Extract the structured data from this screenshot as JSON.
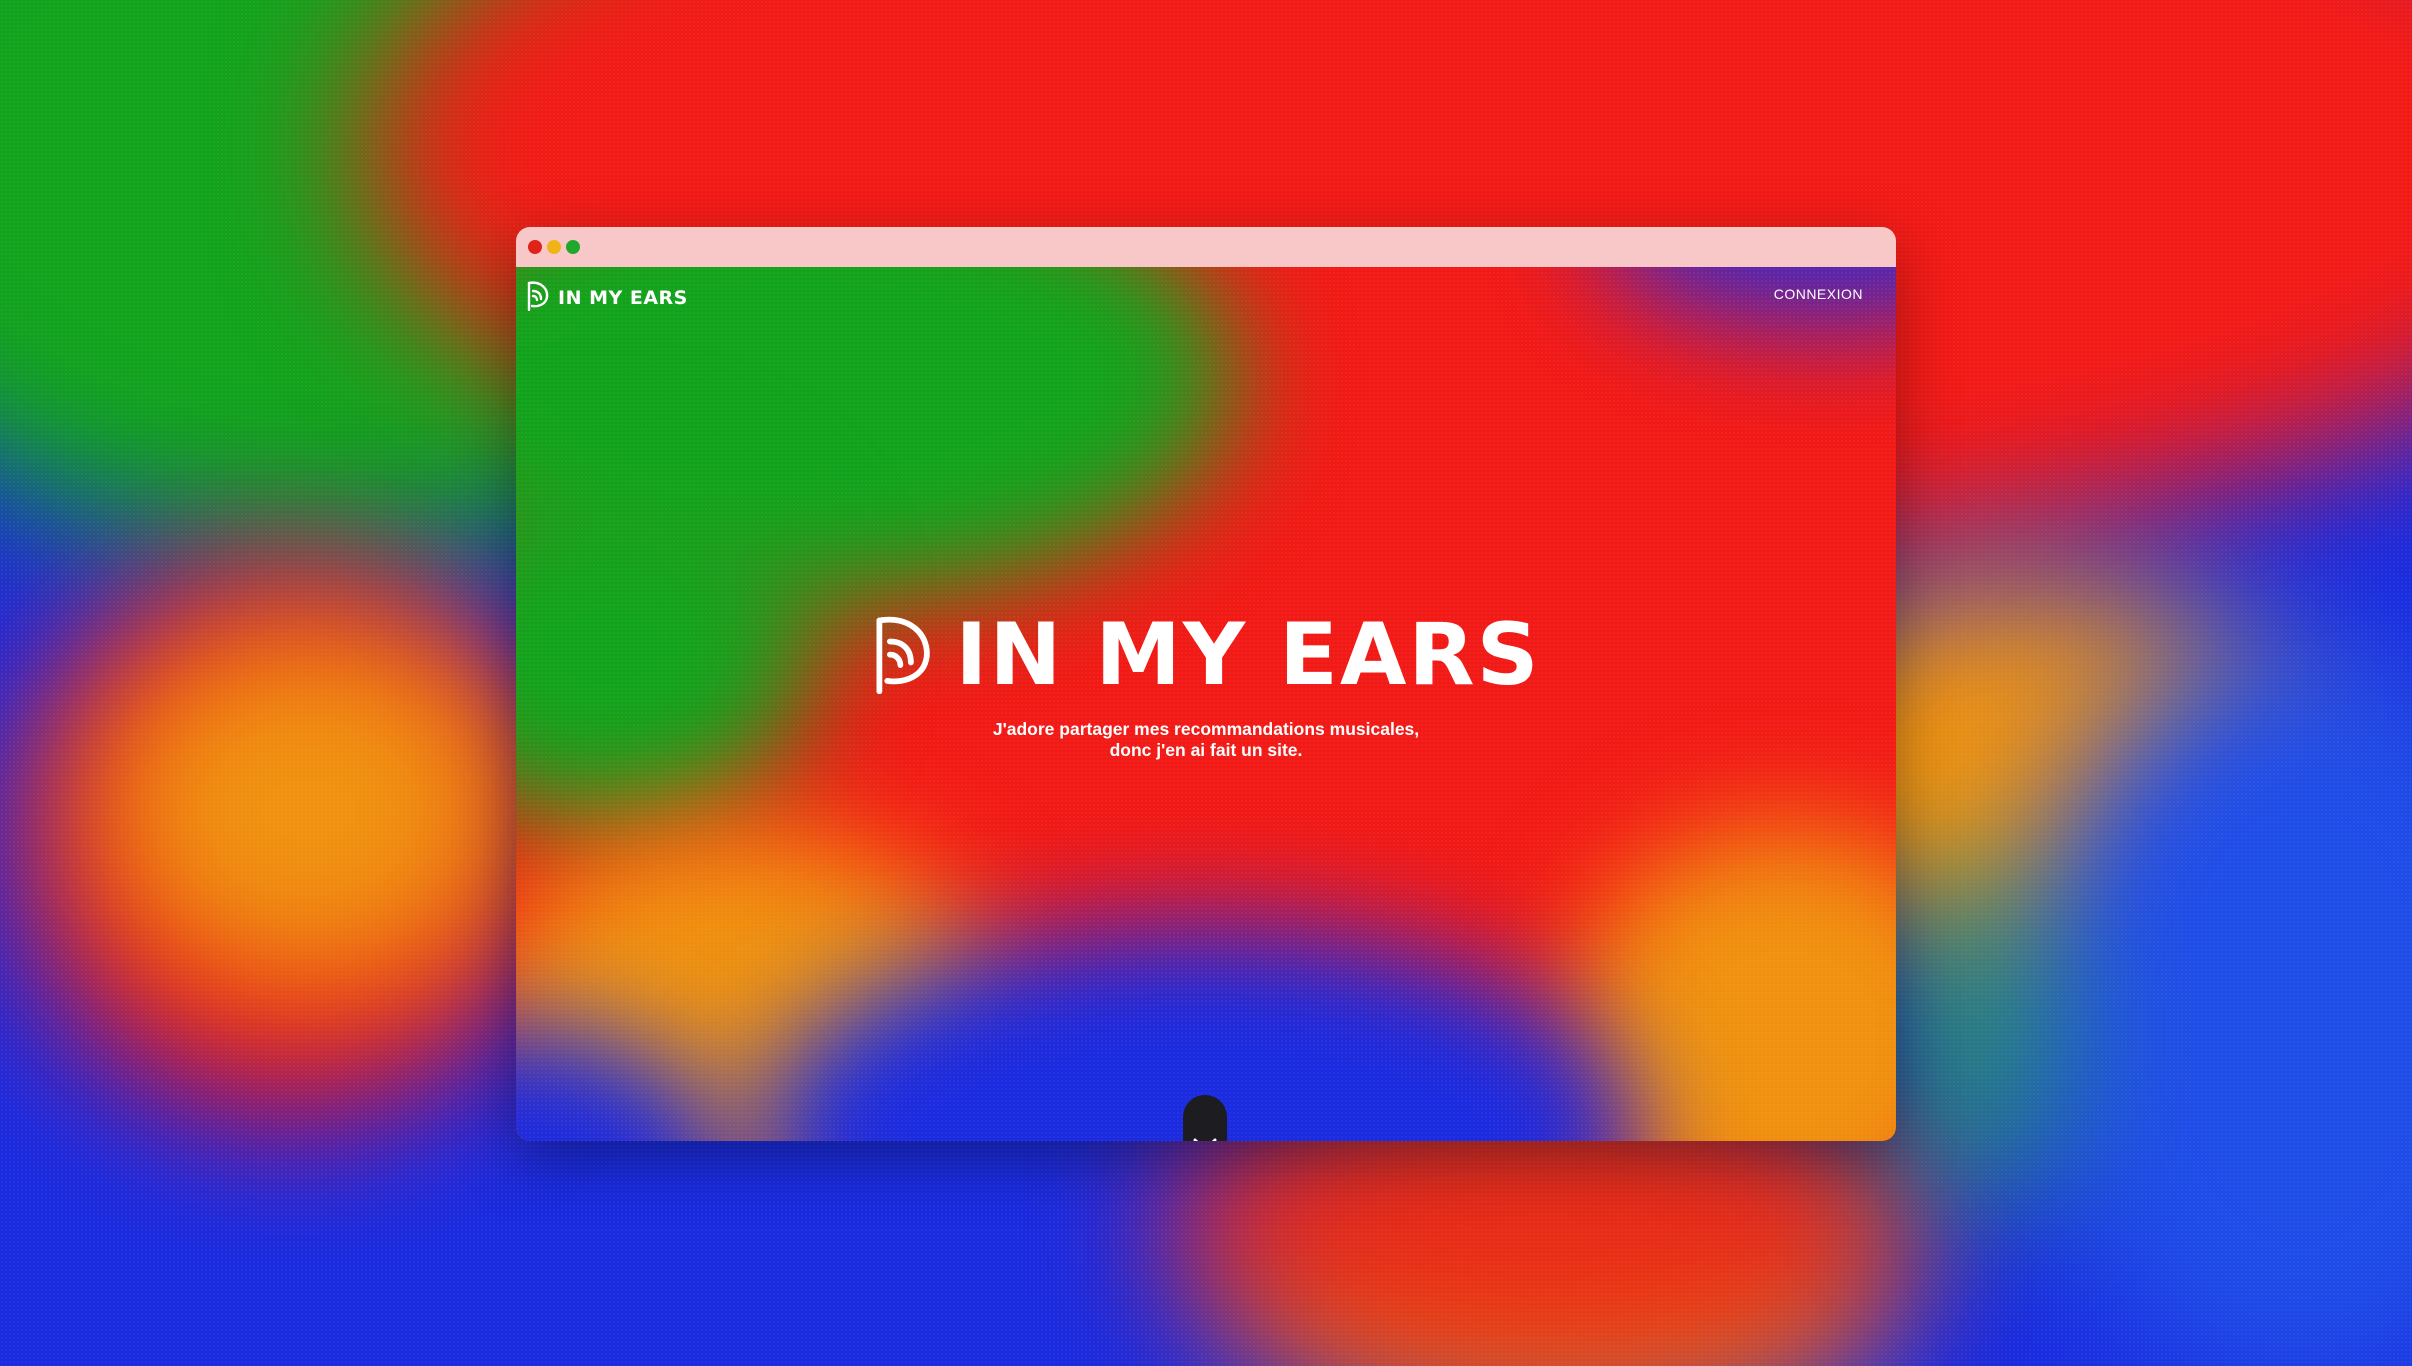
{
  "window": {
    "controls": [
      "close",
      "minimize",
      "maximize"
    ]
  },
  "nav": {
    "brand": "IN MY EARS",
    "logo_icon": "ear-icon",
    "login_label": "CONNEXION"
  },
  "hero": {
    "title": "IN MY EARS",
    "logo_icon": "ear-icon",
    "subtitle_line1": "J'adore partager mes recommandations musicales,",
    "subtitle_line2": "donc j'en ai fait un site."
  },
  "scroll_button": {
    "icon": "chevron-down-icon"
  },
  "colors": {
    "green": "#12a31c",
    "red": "#f21a16",
    "blue": "#1a2be0",
    "orange": "#f0920f",
    "titlebar": "#f8c8c8",
    "button": "#1d1d21"
  }
}
